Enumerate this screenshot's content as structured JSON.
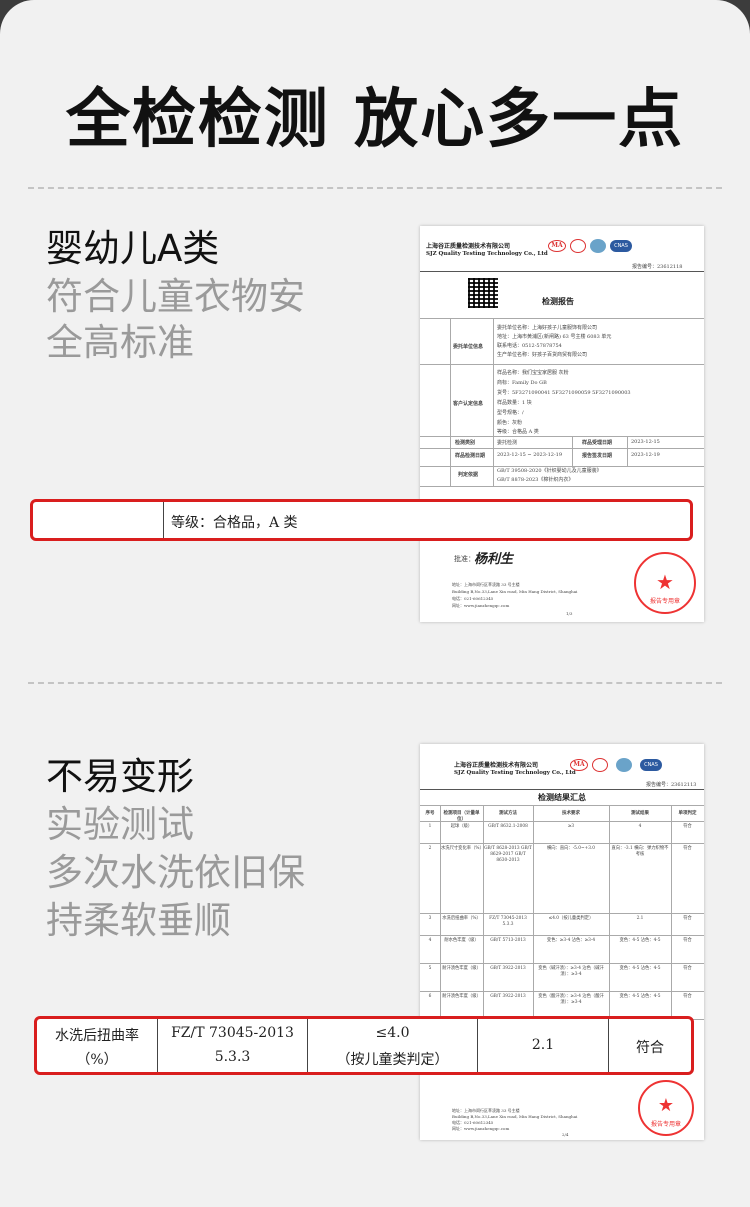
{
  "page": {
    "title": "全检检测 放心多一点"
  },
  "section1": {
    "headline": "婴幼儿A类",
    "sublines": [
      "符合儿童衣物安",
      "全高标准"
    ],
    "doc": {
      "company_cn": "上海谷正质量检测技术有限公司",
      "company_en": "SJZ Quality Testing Technology Co., Ltd",
      "report_no": "报告编号：23612118",
      "title": "检测报告",
      "client_label": "委托单位信息",
      "client_lines": [
        "委托单位名称：上海好孩子儿童服饰有限公司",
        "地址：上海市黄浦区(新闸路) 63 号主楼 6083 单元",
        "联系电话：0512-57878754",
        "生产单位名称：好孩子百货商贸有限公司"
      ],
      "sample_label": "客户认定信息",
      "sample_lines": [
        "样品名称：我们宝宝家居服 灰粉",
        "商标：Family Do GB",
        "货号：5F3271090041 5F3271090059 5F3271090003",
        "样品数量：1 块",
        "型号规格：/",
        "颜色：灰粉",
        "等级：合格品  A 类"
      ],
      "test_type_label": "检测类别",
      "test_type": "委托检测",
      "recv_label": "样品受理日期",
      "recv_date": "2023-12-15",
      "period_label": "样品检测日期",
      "period": "2023-12-15 ~ 2023-12-19",
      "issue_label": "报告签发日期",
      "issue_date": "2023-12-19",
      "basis_label": "判定依据",
      "basis_lines": [
        "GB/T 39508-2020《针织婴幼儿及儿童服装》",
        "GB/T 8878-2023《棉针织内衣》"
      ],
      "approve_label": "批准：",
      "signature": "杨利生",
      "address_lines": [
        "地址：上海市闵行区莘凌路 33 号主楼",
        "Building B,No.33,Lane Xin road, Min Hang District, Shanghai",
        "电话：021-60612345",
        "网址：www.jianzhengqc.com"
      ],
      "page_no": "1/3",
      "stamp_text": "报告专用章"
    },
    "zoom": {
      "left": "",
      "text": "等级：合格品，A 类"
    }
  },
  "section2": {
    "headline": "不易变形",
    "sublines": [
      "实验测试",
      "多次水洗依旧保",
      "持柔软垂顺"
    ],
    "doc": {
      "company_cn": "上海谷正质量检测技术有限公司",
      "company_en": "SJZ Quality Testing Technology Co., Ltd",
      "report_no": "报告编号：23612113",
      "title": "检测结果汇总",
      "headers": [
        "序号",
        "检测项目（计量单位）",
        "测试方法",
        "技术要求",
        "测试结果",
        "单项判定"
      ],
      "rows": [
        [
          "1",
          "起球（级）",
          "GB/T 8632.1-2008",
          "≥3",
          "4",
          "符合"
        ],
        [
          "2",
          "水洗尺寸变化率（%）",
          "GB/T 8628-2013 GB/T 8629-2017 GB/T 8630-2013",
          "横向：直向：-5.0~+3.0",
          "直向：-3.1 横向：弹力织物不考核",
          "符合"
        ],
        [
          "3",
          "水洗后扭曲率（%）",
          "FZ/T 73045-2013 5.3.3",
          "≤4.0（按儿童类判定）",
          "2.1",
          "符合"
        ],
        [
          "4",
          "耐水色牢度（级）",
          "GB/T 5713-2013",
          "变色：≥3-4 沾色：≥3-4",
          "变色：4-5 沾色：4-5",
          "符合"
        ],
        [
          "5",
          "耐汗渍色牢度（级）",
          "GB/T 3922-2013",
          "变色（碱汗渍）：≥3-4 沾色（碱汗渍）：≥3-4",
          "变色：4-5 沾色：4-5",
          "符合"
        ],
        [
          "6",
          "耐汗渍色牢度（级）",
          "GB/T 3922-2013",
          "变色（酸汗渍）：≥3-4 沾色（酸汗渍）：≥3-4",
          "变色：4-5 沾色：4-5",
          "符合"
        ]
      ],
      "address_lines": [
        "地址：上海市闵行区莘凌路 33 号主楼",
        "Building B,No.33,Lane Xin road, Min Hang District, Shanghai",
        "电话：021-60612345",
        "网址：www.jianzhengqc.com"
      ],
      "page_no": "2/4",
      "stamp_text": "报告专用章"
    },
    "zoom": {
      "item": [
        "水洗后扭曲率",
        "（%）"
      ],
      "method": [
        "FZ/T 73045-2013",
        "5.3.3"
      ],
      "req": [
        "≤4.0",
        "（按儿童类判定）"
      ],
      "result": "2.1",
      "judge": "符合"
    }
  }
}
